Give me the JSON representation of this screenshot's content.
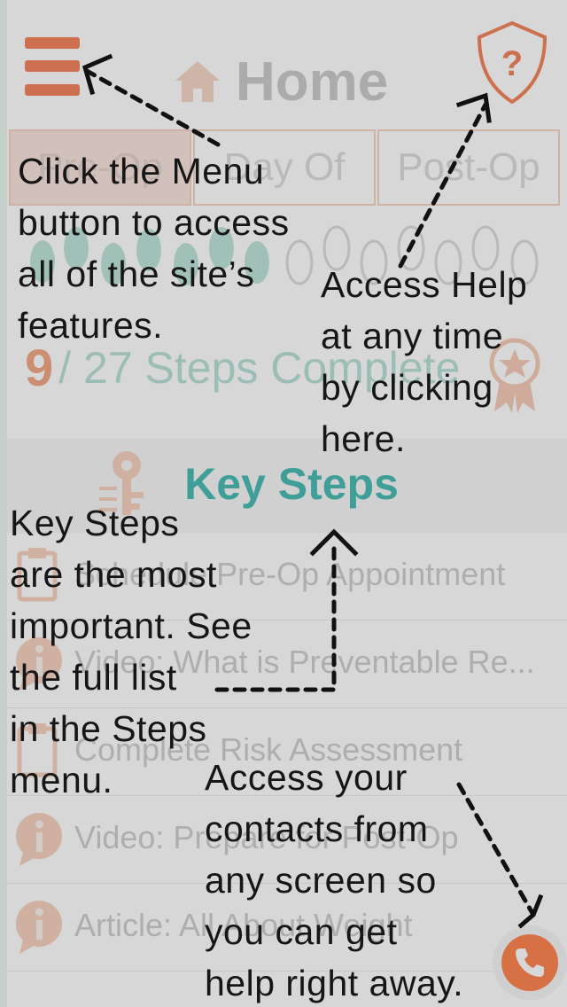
{
  "header": {
    "menu_icon": "hamburger-icon",
    "home_icon": "house-icon",
    "title": "Home",
    "help_icon": "shield-question-icon"
  },
  "tabs": [
    {
      "label": "Pre-Op",
      "active": true
    },
    {
      "label": "Day Of",
      "active": false
    },
    {
      "label": "Post-Op",
      "active": false
    }
  ],
  "progress": {
    "current": "9",
    "text": "/ 27 Steps Complete",
    "completed": 9,
    "total": 27,
    "icon": "award-ribbon-icon"
  },
  "key_steps": {
    "title": "Key Steps",
    "icon": "key-icon",
    "items": [
      {
        "label": "Schedule Pre-Op Appointment",
        "icon": "clipboard-icon"
      },
      {
        "label": "Video: What is Preventable Re...",
        "icon": "info-bubble-icon"
      },
      {
        "label": "Complete Risk Assessment",
        "icon": "clipboard-icon"
      },
      {
        "label": "Video: Prepare for Post-Op",
        "icon": "info-bubble-icon"
      },
      {
        "label": "Article: All About Weight",
        "icon": "info-bubble-icon"
      }
    ]
  },
  "contacts_button": {
    "icon": "phone-icon"
  },
  "tutorial": {
    "menu_tip": "Click the Menu\nbutton to access\nall of the site’s\nfeatures.",
    "help_tip": "Access Help\nat any time\nby clicking\nhere.",
    "key_steps_tip": "Key Steps\nare the most\nimportant. See\nthe full list\nin the Steps\nmenu.",
    "contacts_tip": "Access your\ncontacts from\nany screen so\nyou can get\nhelp right away."
  },
  "colors": {
    "accent_orange": "#ee5a24",
    "accent_teal": "#0aa59a",
    "overlay": "rgba(150,150,150,0.38)"
  }
}
